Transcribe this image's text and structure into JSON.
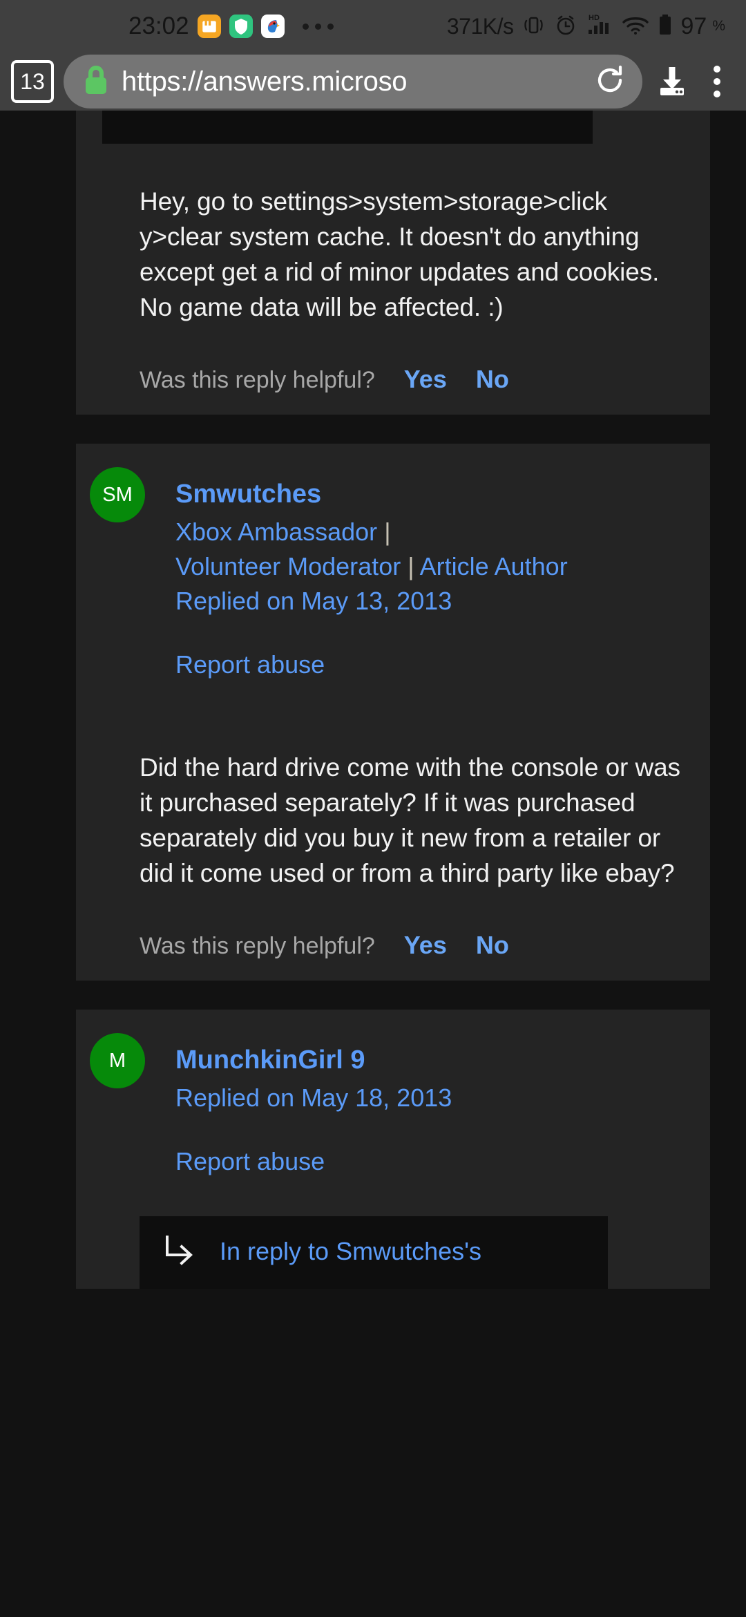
{
  "status_bar": {
    "clock": "23:02",
    "notification_icons": [
      "folder-icon",
      "shield-icon",
      "parrot-icon"
    ],
    "overflow": "more-notifications-dots",
    "network_speed": "371K/s",
    "icons": [
      "vibrate-icon",
      "alarm-clock-icon",
      "hd-signal-icon",
      "wifi-icon",
      "battery-icon"
    ],
    "battery_percent": "97",
    "battery_symbol": "%"
  },
  "browser": {
    "tab_count": "13",
    "lock_icon": "lock-icon",
    "url": "https://answers.microso",
    "reload_icon": "reload-icon",
    "download_icon": "download-icon",
    "menu_icon": "kebab-menu-icon"
  },
  "page": {
    "top_partial_quote": "",
    "replies": [
      {
        "body": "Hey, go to settings>system>storage>click y>clear system cache. It doesn't do anything except get a rid of minor updates and cookies. No game data will be affected. :)",
        "helpful_question": "Was this reply helpful?",
        "yes_label": "Yes",
        "no_label": "No"
      },
      {
        "avatar_initials": "SM",
        "avatar_color": "#068a0a",
        "name": "Smwutches",
        "badge_line_1": "Xbox Ambassador",
        "badge_sep": "|",
        "badge_line_2": "Volunteer Moderator",
        "badge_line_3": "Article Author",
        "replied_on": "Replied on May 13, 2013",
        "report_abuse": "Report abuse",
        "body": "Did the hard drive come with the console or was it purchased separately? If it was purchased separately did you buy it new from a retailer or did it come used or from a third party like ebay?",
        "helpful_question": "Was this reply helpful?",
        "yes_label": "Yes",
        "no_label": "No"
      },
      {
        "avatar_initials": "M",
        "avatar_color": "#068a0a",
        "name": "MunchkinGirl 9",
        "replied_on": "Replied on May 18, 2013",
        "report_abuse": "Report abuse",
        "in_reply_to": "In reply to Smwutches's",
        "reply_arrow_icon": "reply-arrow-icon"
      }
    ]
  },
  "colors": {
    "link": "#5b9bf8",
    "card_bg": "#242424",
    "page_bg": "#121212",
    "quote_bg": "#0e0e0e",
    "chrome_bg": "#404040",
    "urlbar_bg": "#757575",
    "avatar_green": "#068a0a",
    "muted_text": "#a8a8a8"
  }
}
